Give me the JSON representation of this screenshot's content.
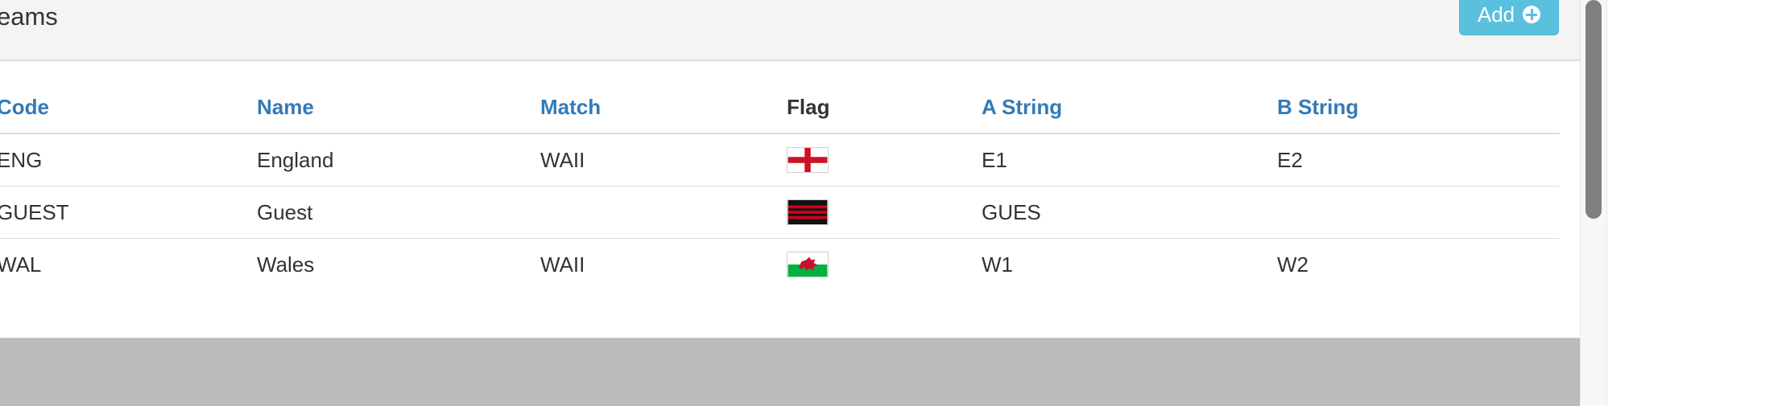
{
  "panel": {
    "title": "eams",
    "add_label": "Add"
  },
  "table": {
    "columns": [
      "Code",
      "Name",
      "Match",
      "Flag",
      "A String",
      "B String"
    ],
    "rows": [
      {
        "code": "ENG",
        "name": "England",
        "match": "WAII",
        "flag": "england-flag",
        "a_string": "E1",
        "b_string": "E2"
      },
      {
        "code": "GUEST",
        "name": "Guest",
        "match": "",
        "flag": "guest-flag",
        "a_string": "GUES",
        "b_string": ""
      },
      {
        "code": "WAL",
        "name": "Wales",
        "match": "WAII",
        "flag": "wales-flag",
        "a_string": "W1",
        "b_string": "W2"
      }
    ]
  },
  "colors": {
    "link": "#337ab7",
    "button": "#5bc0de",
    "header_bg": "#f4f4f4",
    "footer_bg": "#bbbbbb"
  }
}
